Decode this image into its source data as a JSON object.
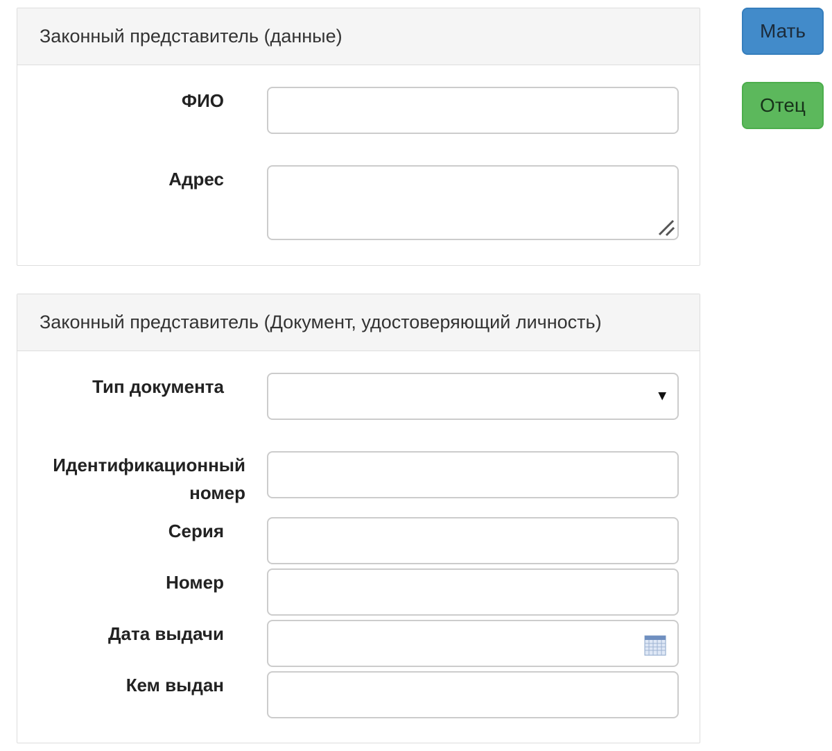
{
  "panel_data": {
    "heading": "Законный представитель (данные)",
    "fio_label": "ФИО",
    "fio_value": "",
    "address_label": "Адрес",
    "address_value": ""
  },
  "panel_document": {
    "heading": "Законный представитель (Документ, удостоверяющий личность)",
    "doc_type_label": "Тип документа",
    "doc_type_selected": "",
    "id_number_label_line1": "Идентификационный",
    "id_number_label_line2": "номер",
    "id_number_value": "",
    "series_label": "Серия",
    "series_value": "",
    "number_label": "Номер",
    "number_value": "",
    "issue_date_label": "Дата выдачи",
    "issue_date_value": "",
    "issued_by_label": "Кем выдан",
    "issued_by_value": ""
  },
  "side_buttons": {
    "mother_label": "Мать",
    "father_label": "Отец"
  },
  "icons": {
    "select_caret": "chevron-down-icon",
    "calendar": "calendar-icon",
    "resize": "resize-handle-icon"
  },
  "colors": {
    "mother_button": "#428bca",
    "father_button": "#5cb85c",
    "panel_heading_bg": "#f5f5f5",
    "border": "#dddddd"
  }
}
